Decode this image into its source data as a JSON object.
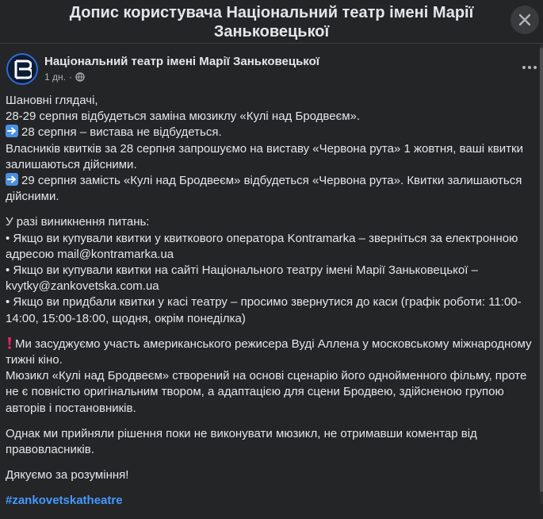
{
  "dialog": {
    "title": "Допис користувача Національний театр імені Марії Заньковецької"
  },
  "post": {
    "author": "Національний театр імені Марії Заньковецької",
    "time": "1 дн.",
    "separator": "·",
    "audience_icon": "globe-icon",
    "avatar_icon": "theatre-logo",
    "lines": {
      "l1": "Шановні глядачі,",
      "l2": "28-29 серпня відбудеться заміна мюзиклу «Кулі над Бродвеєм».",
      "l3": "28 серпня – вистава не відбудеться.",
      "l4": "Власників квитків за 28 серпня запрошуємо на виставу «Червона рута» 1 жовтня, ваші квитки",
      "l5": "залишаються дійсними.",
      "l6": "29 серпня замість «Кулі над Бродвеєм» відбудеться «Червона рута». Квитки залишаються",
      "l7": "дійсними.",
      "l8": "У разі виникнення питань:",
      "l9": "• Якщо ви купували квитки у квиткового оператора Kontramarka – зверніться за електронною",
      "l10": "адресою mail@kontramarka.ua",
      "l11": "• Якщо ви купували квитки на сайті Національного театру імені Марії Заньковецької –",
      "l12": "kvytky@zankovetska.com.ua",
      "l13": "• Якщо ви придбали квитки у касі театру – просимо звернутися до каси (графік роботи: 11:00-",
      "l14": "14:00, 15:00-18:00, щодня, окрім понеділка)",
      "l15": "Ми засуджуємо участь американського режисера Вуді Аллена у московському міжнародному",
      "l16": "тижні кіно.",
      "l17": "Мюзикл «Кулі над Бродвеєм» створений на основі сценарію його однойменного фільму, проте",
      "l18": "не є повністю оригінальним твором, а адаптацією для сцени Бродвею, здійсненою групою",
      "l19": "авторів і постановників.",
      "l20": "Однак ми прийняли рішення поки не виконувати мюзикл, не отримавши коментар від",
      "l21": "правовласників.",
      "l22": "Дякуємо за розуміння!",
      "hashtag": "#zankovetskatheatre"
    }
  },
  "colors": {
    "background": "#242526",
    "text": "#e4e6eb",
    "secondary_text": "#b0b3b8",
    "link": "#4599ff",
    "arrow_emoji": "#4a90e2",
    "exclamation_emoji": "#e0245e"
  }
}
